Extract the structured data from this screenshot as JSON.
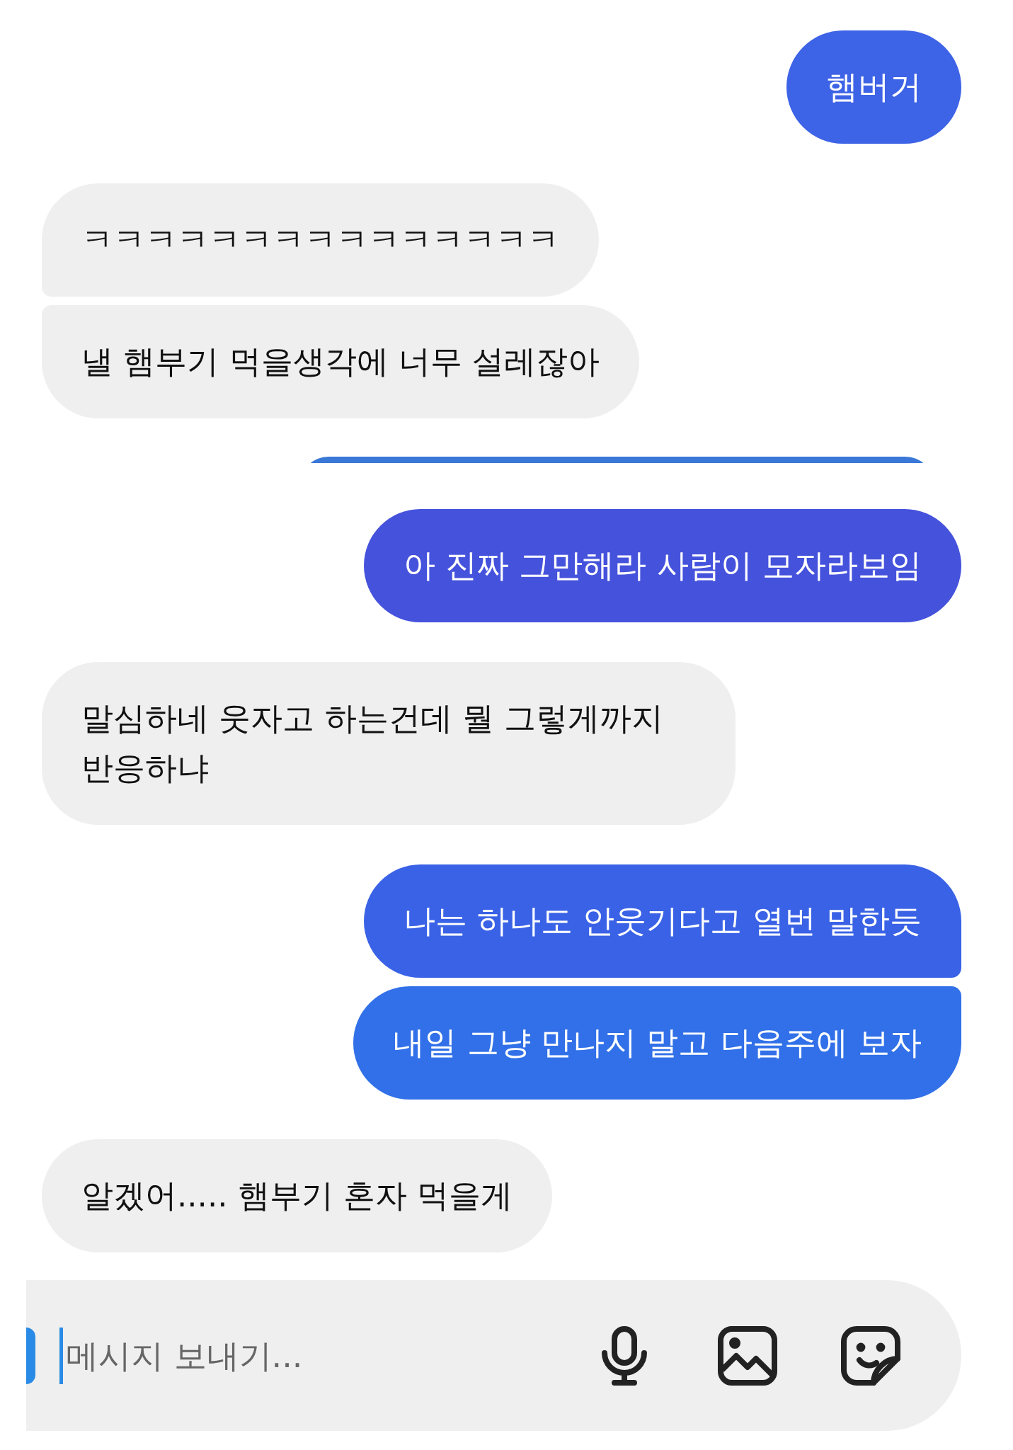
{
  "messages": [
    {
      "kind": "sent",
      "text": "햄버거",
      "color": "#3d63e6"
    },
    {
      "kind": "received",
      "text": "ㅋㅋㅋㅋㅋㅋㅋㅋㅋㅋㅋㅋㅋㅋㅋ",
      "color": "#efefef"
    },
    {
      "kind": "received",
      "text": "낼 햄부기 먹을생각에 너무 설레잖아",
      "color": "#efefef"
    },
    {
      "kind": "partial",
      "color": "#3a78d8"
    },
    {
      "kind": "sent",
      "text": "아 진짜 그만해라 사람이 모자라보임",
      "color": "#4552dc"
    },
    {
      "kind": "received",
      "text": "말심하네 웃자고 하는건데 뭘 그렇게까지 반응하냐",
      "color": "#efefef"
    },
    {
      "kind": "sent",
      "text": "나는 하나도 안웃기다고 열번 말한듯",
      "color": "#3a62e6"
    },
    {
      "kind": "sent",
      "text": "내일 그냥 만나지 말고 다음주에 보자",
      "color": "#3170e8"
    },
    {
      "kind": "received",
      "text": "알겠어..... 햄부기 혼자 먹을게",
      "color": "#efefef"
    }
  ],
  "composer": {
    "placeholder": "메시지 보내기..."
  }
}
